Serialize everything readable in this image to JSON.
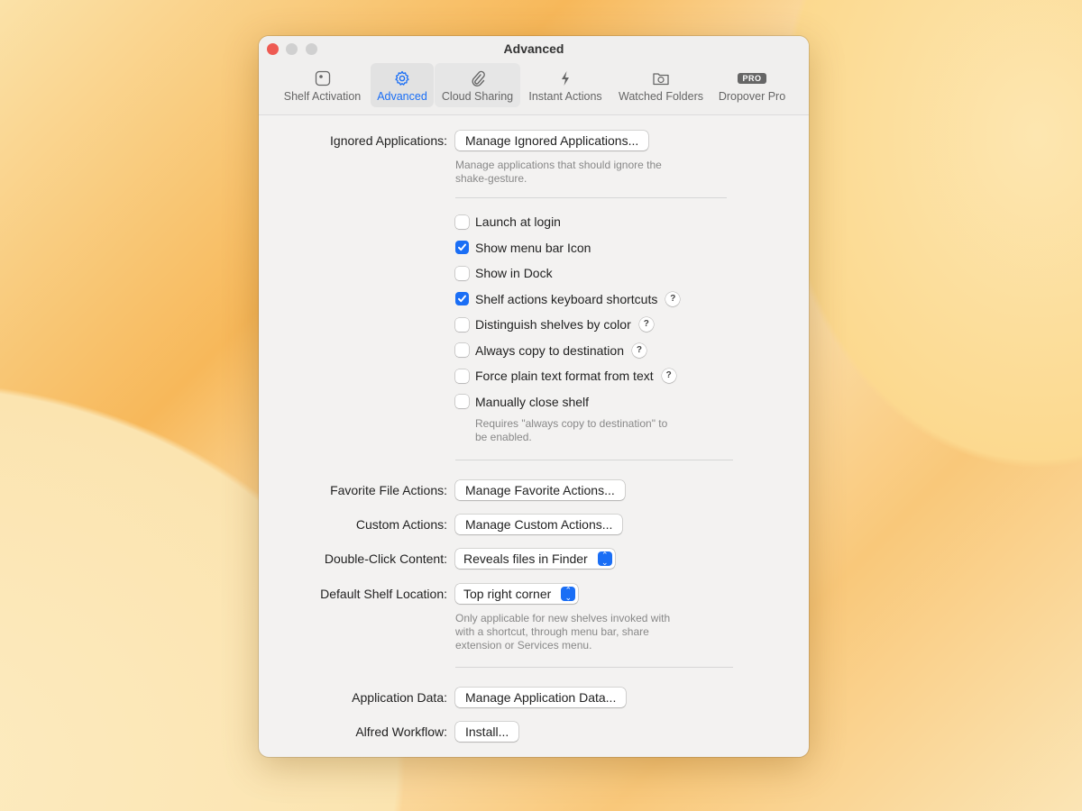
{
  "window": {
    "title": "Advanced"
  },
  "tabs": [
    {
      "label": "Shelf Activation",
      "icon": "shelf-icon"
    },
    {
      "label": "Advanced",
      "icon": "gear-icon"
    },
    {
      "label": "Cloud Sharing",
      "icon": "paperclip-icon"
    },
    {
      "label": "Instant Actions",
      "icon": "bolt-icon"
    },
    {
      "label": "Watched Folders",
      "icon": "folder-sync-icon"
    },
    {
      "label": "Dropover Pro",
      "icon": "pro-badge-icon",
      "badge": "PRO"
    }
  ],
  "ignored": {
    "label": "Ignored Applications:",
    "button": "Manage Ignored Applications...",
    "help1": "Manage applications that should ignore the",
    "help2": "shake-gesture."
  },
  "checkboxes": [
    {
      "label": "Launch at login",
      "checked": false,
      "help": false
    },
    {
      "label": "Show menu bar Icon",
      "checked": true,
      "help": false
    },
    {
      "label": "Show in Dock",
      "checked": false,
      "help": false
    },
    {
      "label": "Shelf actions keyboard shortcuts",
      "checked": true,
      "help": true
    },
    {
      "label": "Distinguish shelves by color",
      "checked": false,
      "help": true
    },
    {
      "label": "Always copy to destination",
      "checked": false,
      "help": true
    },
    {
      "label": "Force plain text format from text",
      "checked": false,
      "help": true
    },
    {
      "label": "Manually close shelf",
      "checked": false,
      "help": false
    }
  ],
  "manual_help1": "Requires \"always copy to destination\" to",
  "manual_help2": "be enabled.",
  "favorite": {
    "label": "Favorite File Actions:",
    "button": "Manage Favorite Actions..."
  },
  "custom": {
    "label": "Custom Actions:",
    "button": "Manage Custom Actions..."
  },
  "double_click": {
    "label": "Double-Click Content:",
    "value": "Reveals files in Finder"
  },
  "location": {
    "label": "Default Shelf Location:",
    "value": "Top right corner",
    "help1": "Only applicable for new shelves invoked with",
    "help2": "with a shortcut, through menu bar, share",
    "help3": "extension or Services menu."
  },
  "app_data": {
    "label": "Application Data:",
    "button": "Manage Application Data..."
  },
  "alfred": {
    "label": "Alfred Workflow:",
    "button": "Install..."
  },
  "colors": {
    "accent": "#1a6ef5",
    "close": "#ee5a52"
  }
}
